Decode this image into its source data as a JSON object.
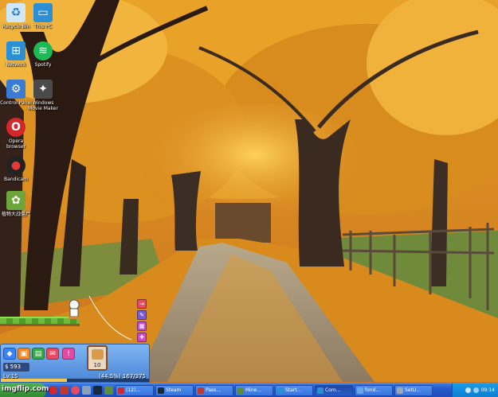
{
  "desktop": {
    "icons": [
      {
        "name": "recycle-bin",
        "label": "Recycle Bin",
        "color": "#cfe7f7",
        "glyph": "♻"
      },
      {
        "name": "this-pc",
        "label": "This PC",
        "color": "#2b8fd6",
        "glyph": "▭"
      },
      {
        "name": "network",
        "label": "Network",
        "color": "#2b8fd6",
        "glyph": "⊞"
      },
      {
        "name": "spotify",
        "label": "Spotify",
        "color": "#1db954",
        "glyph": "≋"
      },
      {
        "name": "control-panel",
        "label": "Control Panel",
        "color": "#3a7bd5",
        "glyph": "⚙"
      },
      {
        "name": "windows-movie-maker",
        "label": "Windows Movie Maker",
        "color": "#4a4a4a",
        "glyph": "✦"
      },
      {
        "name": "opera-browser",
        "label": "Opera browser",
        "color": "#d3272b",
        "glyph": "O"
      },
      {
        "name": "bandicam",
        "label": "Bandicam",
        "color": "#222222",
        "glyph": "●"
      },
      {
        "name": "game-shortcut",
        "label": "植物大战僵尸",
        "color": "#6ca53a",
        "glyph": "✿"
      }
    ]
  },
  "game": {
    "money": "$ 593",
    "item_count": "10",
    "level": "Lv.15",
    "stats": "(44.5%) 167/375",
    "xp_fraction": 0.445
  },
  "taskbar": {
    "start_label": "",
    "tasks": [
      {
        "label": "(12)...",
        "color": "#d3272b"
      },
      {
        "label": "Steam",
        "color": "#1b2838"
      },
      {
        "label": "Pass...",
        "color": "#c0392b"
      },
      {
        "label": "Mine...",
        "color": "#5d8c3a"
      },
      {
        "label": "Start...",
        "color": "#2b8fd6"
      },
      {
        "label": "Com...",
        "color": "#2b8fd6"
      },
      {
        "label": "fond...",
        "color": "#6aa7e8"
      },
      {
        "label": "SetU...",
        "color": "#9aa7b8"
      }
    ],
    "clock": "09:14"
  },
  "watermark": "imgflip.com"
}
